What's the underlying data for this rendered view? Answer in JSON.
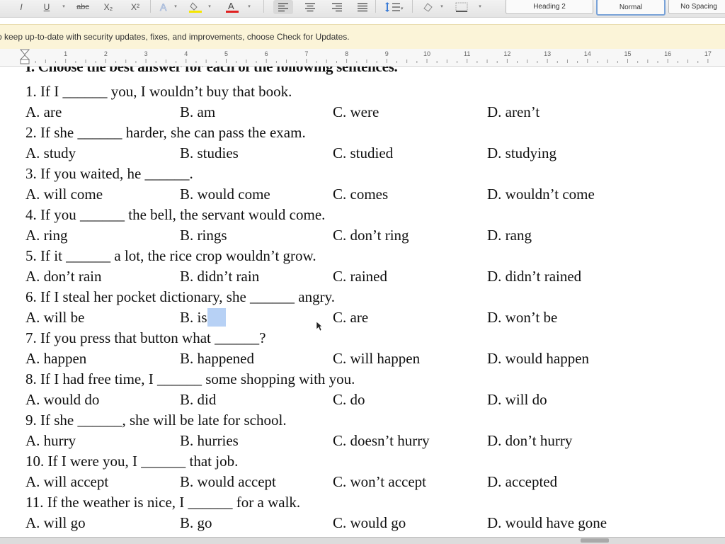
{
  "toolbar": {
    "italic": "I",
    "underline": "U",
    "strikethrough": "abc",
    "subscript": "X₂",
    "superscript": "X²",
    "styles": [
      "Heading 2",
      "Normal",
      "No Spacing"
    ],
    "colors": {
      "highlight": "#f5e600",
      "font_color": "#e02020",
      "selected_style_border": "#7aa3d8"
    }
  },
  "banner": {
    "message": "o keep up-to-date with security updates, fixes, and improvements, choose Check for Updates."
  },
  "ruler": {
    "numbers": [
      "1",
      "2",
      "3",
      "4",
      "5",
      "6",
      "7",
      "8",
      "9",
      "10",
      "11",
      "12",
      "13",
      "14",
      "15",
      "16",
      "17"
    ]
  },
  "document": {
    "heading": "I. Choose the best answer for each of the following sentences.",
    "questions": [
      {
        "stem": "1. If I ______ you, I wouldn’t buy that book.",
        "options": [
          "A. are",
          "B. am",
          "C. were",
          "D. aren’t"
        ]
      },
      {
        "stem": "2. If she ______ harder, she can pass the exam.",
        "options": [
          "A. study",
          "B. studies",
          "C. studied",
          "D. studying"
        ]
      },
      {
        "stem": "3. If you waited, he ______.",
        "options": [
          "A. will come",
          "B. would come",
          "C. comes",
          "D. wouldn’t come"
        ]
      },
      {
        "stem": "4. If you ______ the bell, the servant would come.",
        "options": [
          "A. ring",
          "B. rings",
          "C. don’t ring",
          "D. rang"
        ]
      },
      {
        "stem": "5. If it ______ a lot, the rice crop wouldn’t grow.",
        "options": [
          "A. don’t rain",
          "B. didn’t rain",
          "C. rained",
          "D. didn’t rained"
        ]
      },
      {
        "stem": "6. If I steal her pocket dictionary, she ______ angry.",
        "options": [
          "A. will be",
          "B. is",
          "C. are",
          "D. won’t be"
        ]
      },
      {
        "stem": "7. If you press that button what ______?",
        "options": [
          "A. happen",
          "B. happened",
          "C. will happen",
          "D. would happen"
        ]
      },
      {
        "stem": "8. If I had free time, I ______ some shopping with you.",
        "options": [
          "A. would do",
          "B. did",
          "C. do",
          "D. will do"
        ]
      },
      {
        "stem": "9. If she ______, she will be late for school.",
        "options": [
          "A. hurry",
          "B. hurries",
          "C. doesn’t hurry",
          "D. don’t hurry"
        ]
      },
      {
        "stem": "10. If I were you, I ______ that job.",
        "options": [
          "A. will accept",
          "B. would accept",
          "C. won’t accept",
          "D. accepted"
        ]
      },
      {
        "stem": "11. If the weather is nice, I ______ for a walk.",
        "options": [
          "A. will go",
          "B. go",
          "C. would go",
          "D. would have gone"
        ]
      }
    ]
  }
}
